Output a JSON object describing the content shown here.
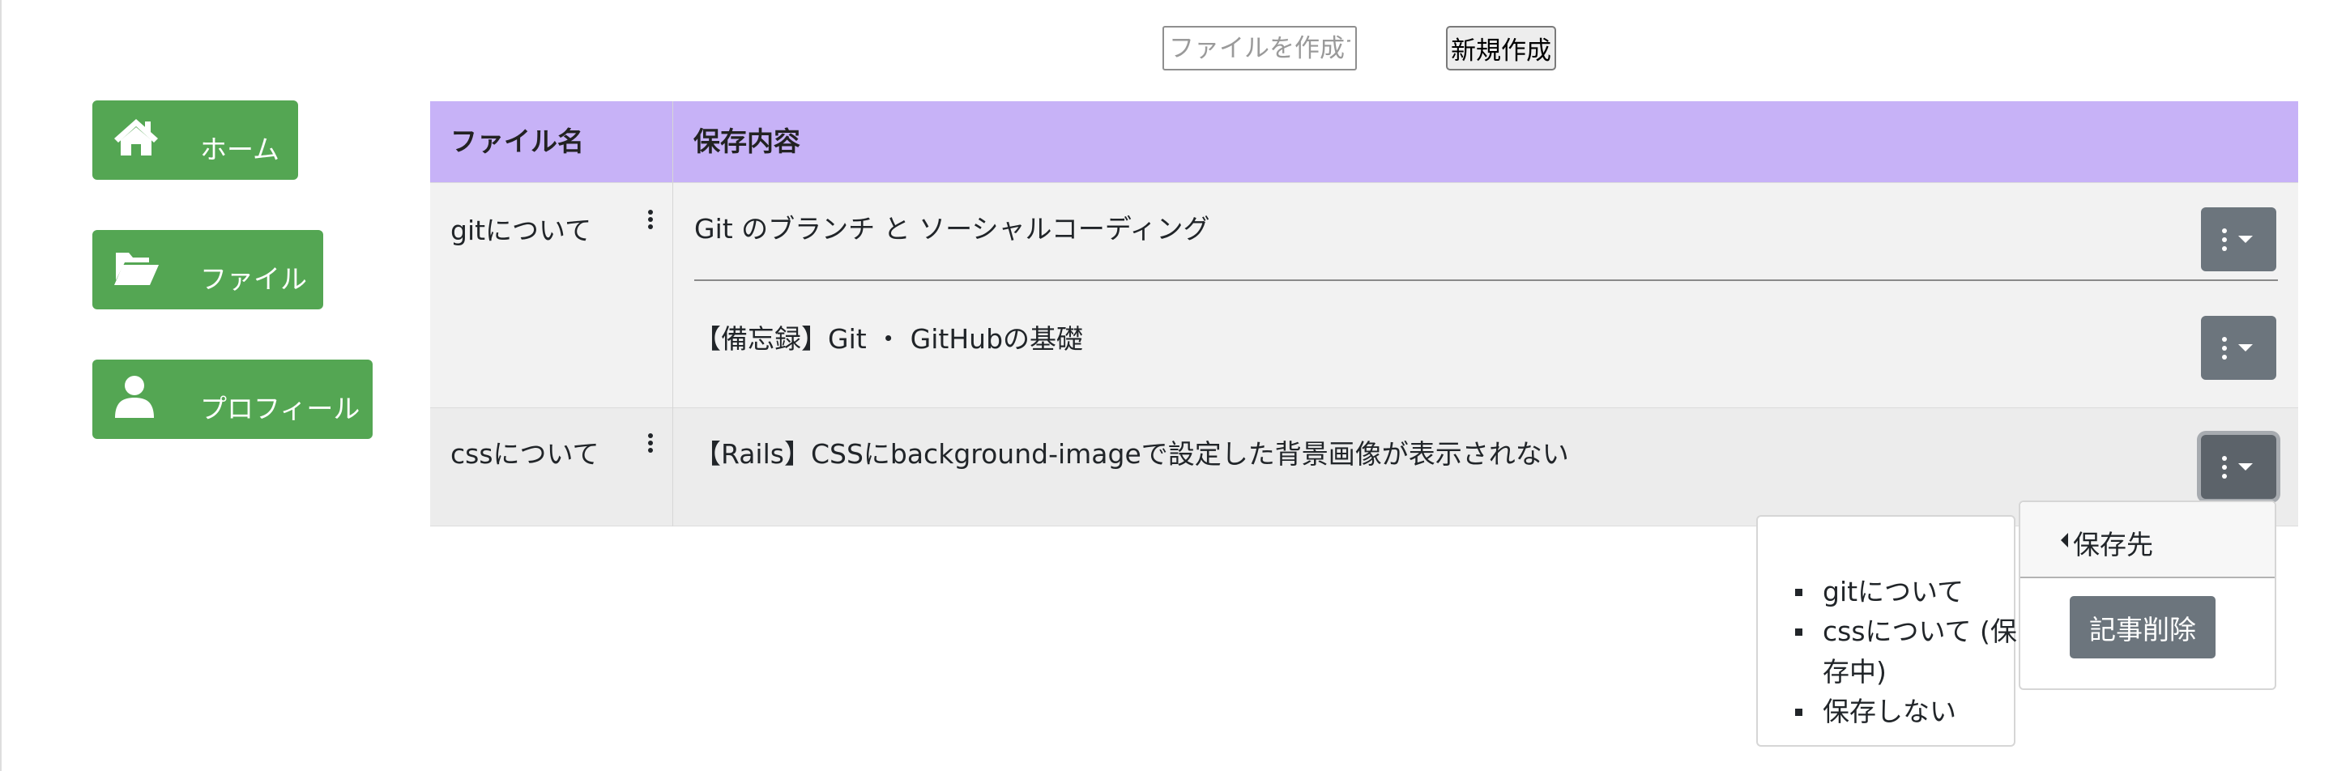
{
  "toolbar": {
    "create_placeholder": "ファイルを作成する",
    "create_button_label": "新規作成"
  },
  "sidebar": {
    "items": [
      {
        "label": "ホーム",
        "icon": "home-icon"
      },
      {
        "label": "ファイル",
        "icon": "folder-open-icon"
      },
      {
        "label": "プロフィール",
        "icon": "user-icon"
      }
    ]
  },
  "table": {
    "headers": {
      "filename": "ファイル名",
      "content": "保存内容"
    },
    "rows": [
      {
        "filename": "gitについて",
        "articles": [
          "Git のブランチ と ソーシャルコーディング",
          "【備忘録】Git ・ GitHubの基礎"
        ]
      },
      {
        "filename": "cssについて",
        "articles": [
          "【Rails】CSSにbackground-imageで設定した背景画像が表示されない"
        ]
      }
    ]
  },
  "dropdown": {
    "submenu_label": "保存先",
    "delete_label": "記事削除",
    "save_targets": [
      "gitについて",
      "cssについて (保存中)",
      "保存しない"
    ]
  },
  "colors": {
    "nav_green": "#54a653",
    "header_purple": "#c7b2f7",
    "secondary_gray": "#6c757d"
  }
}
